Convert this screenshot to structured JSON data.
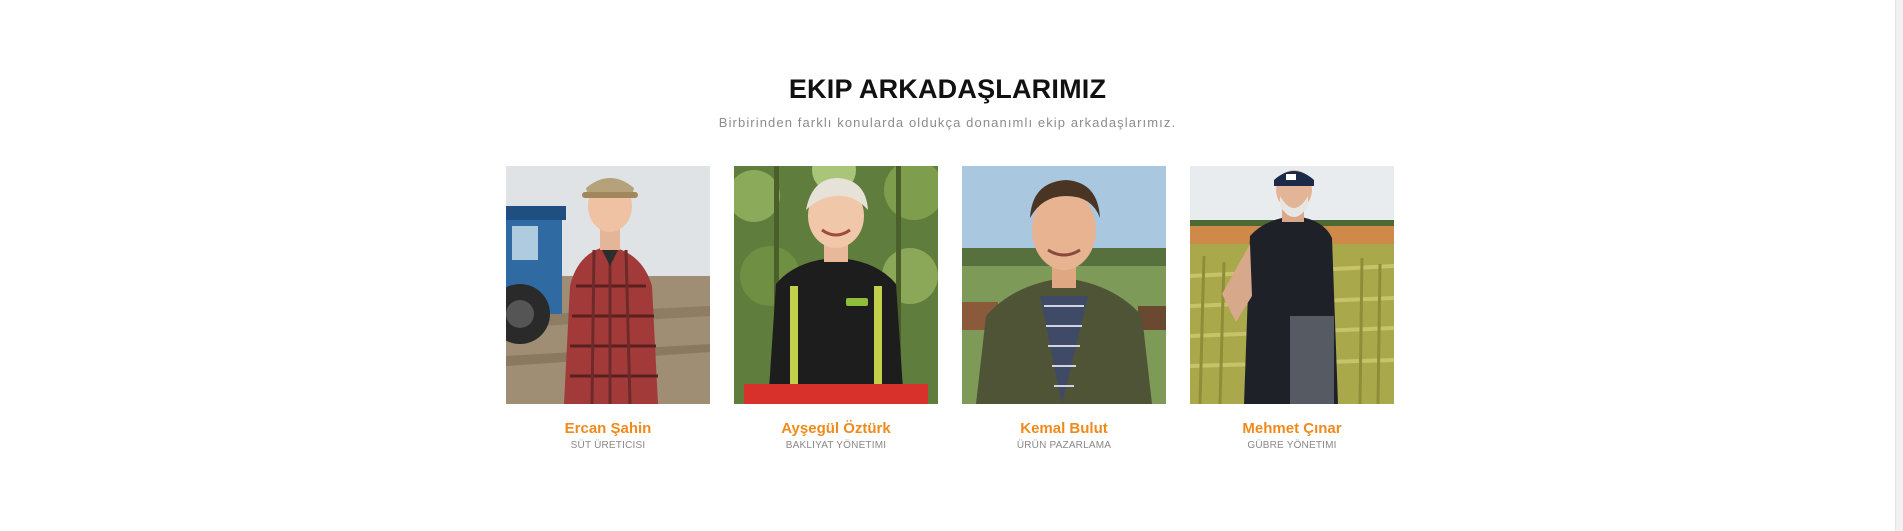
{
  "section": {
    "title": "EKIP ARKADAŞLARIMIZ",
    "subtitle": "Birbirinden farklı konularda oldukça donanımlı ekip arkadaşlarımız."
  },
  "members": [
    {
      "name": "Ercan Şahin",
      "role": "SÜT ÜRETICISI",
      "photo": "farmer-with-tractor-photo"
    },
    {
      "name": "Ayşegül Öztürk",
      "role": "BAKLIYAT YÖNETIMI",
      "photo": "woman-in-orchard-photo"
    },
    {
      "name": "Kemal Bulut",
      "role": "ÜRÜN PAZARLAMA",
      "photo": "man-in-field-photo"
    },
    {
      "name": "Mehmet Çınar",
      "role": "GÜBRE YÖNETIMI",
      "photo": "man-in-wheat-field-photo"
    }
  ],
  "colors": {
    "accent": "#ef8a1c",
    "title": "#111111",
    "subtitle": "#8c8c8c",
    "role": "#888888"
  }
}
